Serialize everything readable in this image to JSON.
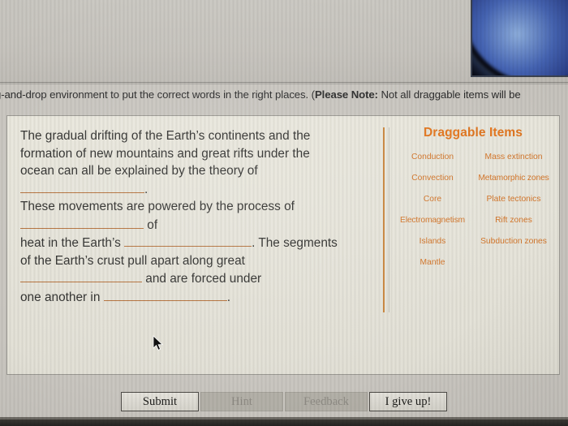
{
  "instruction": {
    "text_before_note": "g-and-drop environment to put the correct words in the right places. (",
    "note_label": "Please Note:",
    "text_after_note": " Not all draggable items will be"
  },
  "question": {
    "line1": "The gradual drifting of the Earth’s continents and the",
    "line2": "formation of new mountains and great rifts under the",
    "line3": "ocean can all be explained by the theory of",
    "period1": ".",
    "line4": "These movements are powered by the process of",
    "word_of": "of",
    "line5": "heat in the Earth’s",
    "after_blank_c": ". The segments",
    "line6": "of the Earth’s crust pull apart along great",
    "after_blank_d": "and are forced under",
    "line7": "one another in",
    "period2": "."
  },
  "drag_panel": {
    "title": "Draggable Items",
    "items": [
      "Conduction",
      "Mass extinction",
      "Convection",
      "Metamorphic zones",
      "Core",
      "Plate tectonics",
      "Electromagnetism",
      "Rift zones",
      "Islands",
      "Subduction zones",
      "Mantle"
    ]
  },
  "buttons": {
    "submit": "Submit",
    "hint": "Hint",
    "feedback": "Feedback",
    "give_up": "I give up!"
  },
  "colors": {
    "accent_orange": "#d4762a",
    "title_orange": "#e2761f",
    "blank_underline": "#b5713b",
    "card_bg": "#e7e5db",
    "page_bg": "#c6c3bd"
  }
}
